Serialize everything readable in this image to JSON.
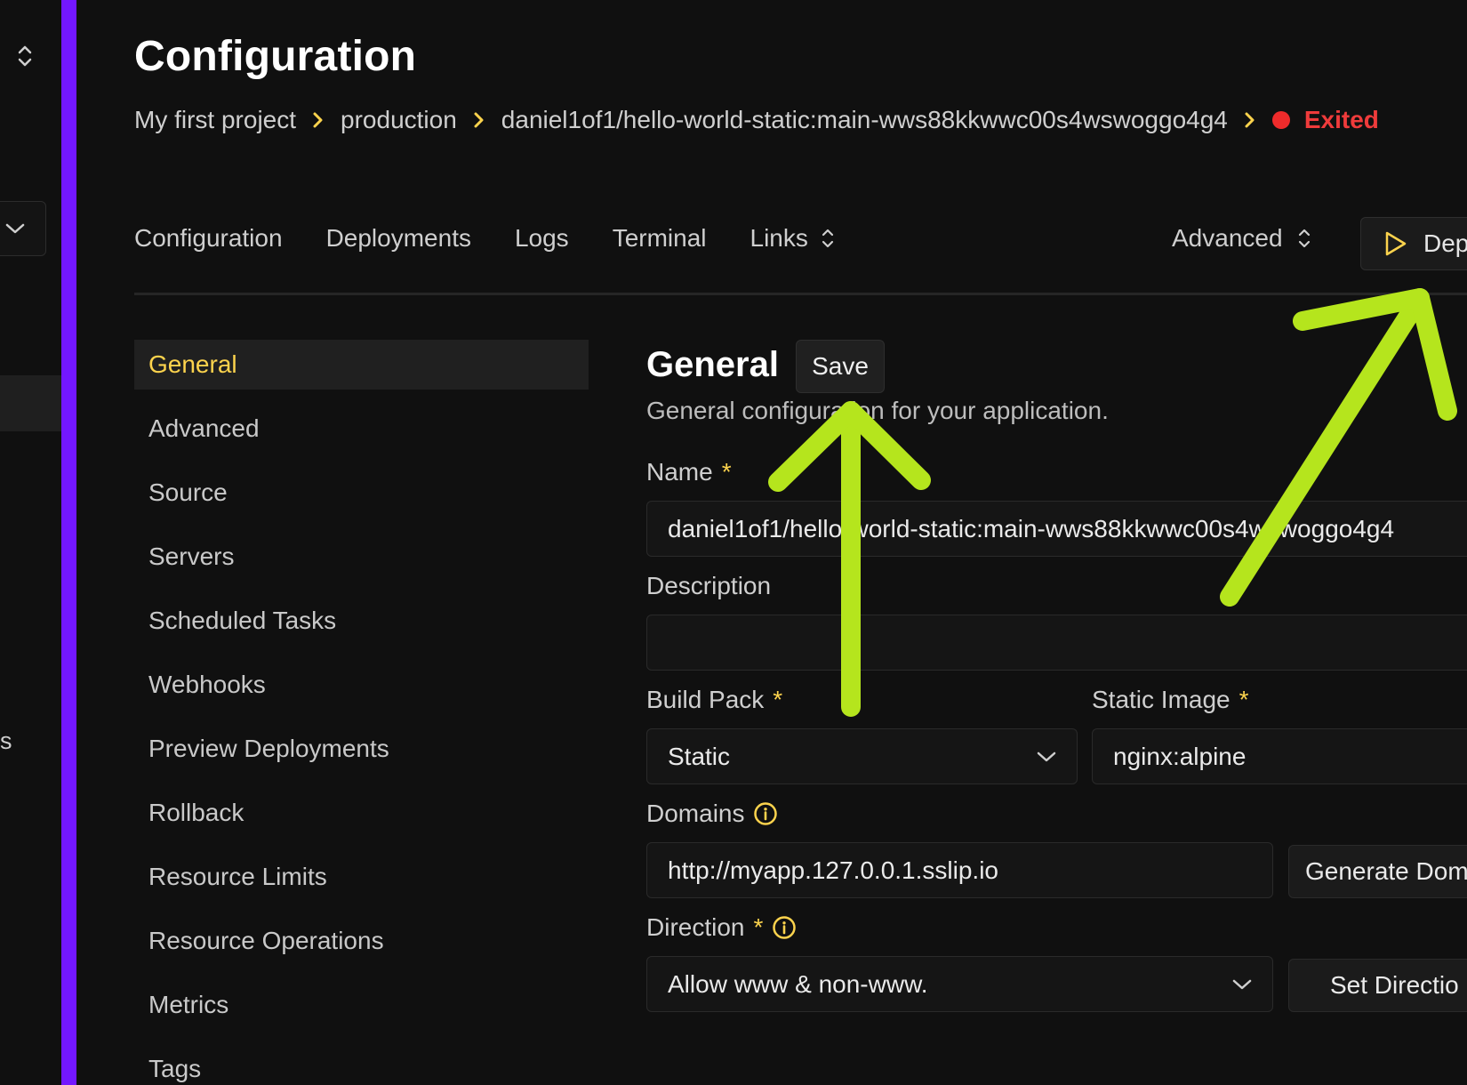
{
  "header": {
    "title": "Configuration",
    "breadcrumb": [
      "My first project",
      "production",
      "daniel1of1/hello-world-static:main-wws88kkwwc00s4wswoggo4g4"
    ],
    "status": "Exited"
  },
  "sidebar_sliver": {
    "partial_label": "s"
  },
  "tabs": {
    "items": [
      "Configuration",
      "Deployments",
      "Logs",
      "Terminal",
      "Links"
    ],
    "advanced": "Advanced",
    "deploy": "Dep"
  },
  "settings_nav": {
    "items": [
      "General",
      "Advanced",
      "Source",
      "Servers",
      "Scheduled Tasks",
      "Webhooks",
      "Preview Deployments",
      "Rollback",
      "Resource Limits",
      "Resource Operations",
      "Metrics",
      "Tags"
    ],
    "active": "General"
  },
  "general": {
    "title": "General",
    "save_label": "Save",
    "subtitle": "General configuration for your application.",
    "name_label": "Name",
    "name_value": "daniel1of1/hello-world-static:main-wws88kkwwc00s4wswoggo4g4",
    "description_label": "Description",
    "description_value": "",
    "build_pack_label": "Build Pack",
    "build_pack_value": "Static",
    "static_image_label": "Static Image",
    "static_image_value": "nginx:alpine",
    "domains_label": "Domains",
    "domains_value": "http://myapp.127.0.0.1.sslip.io",
    "generate_domain_label": "Generate Dom",
    "direction_label": "Direction",
    "direction_value": "Allow www & non-www.",
    "set_direction_label": "Set Directio",
    "required_mark": "*"
  },
  "colors": {
    "accent_yellow": "#fcd34d",
    "purple_bar": "#7317ff",
    "status_red": "#ef2b2b",
    "annotation_green": "#b5e51d",
    "background": "#101010"
  }
}
